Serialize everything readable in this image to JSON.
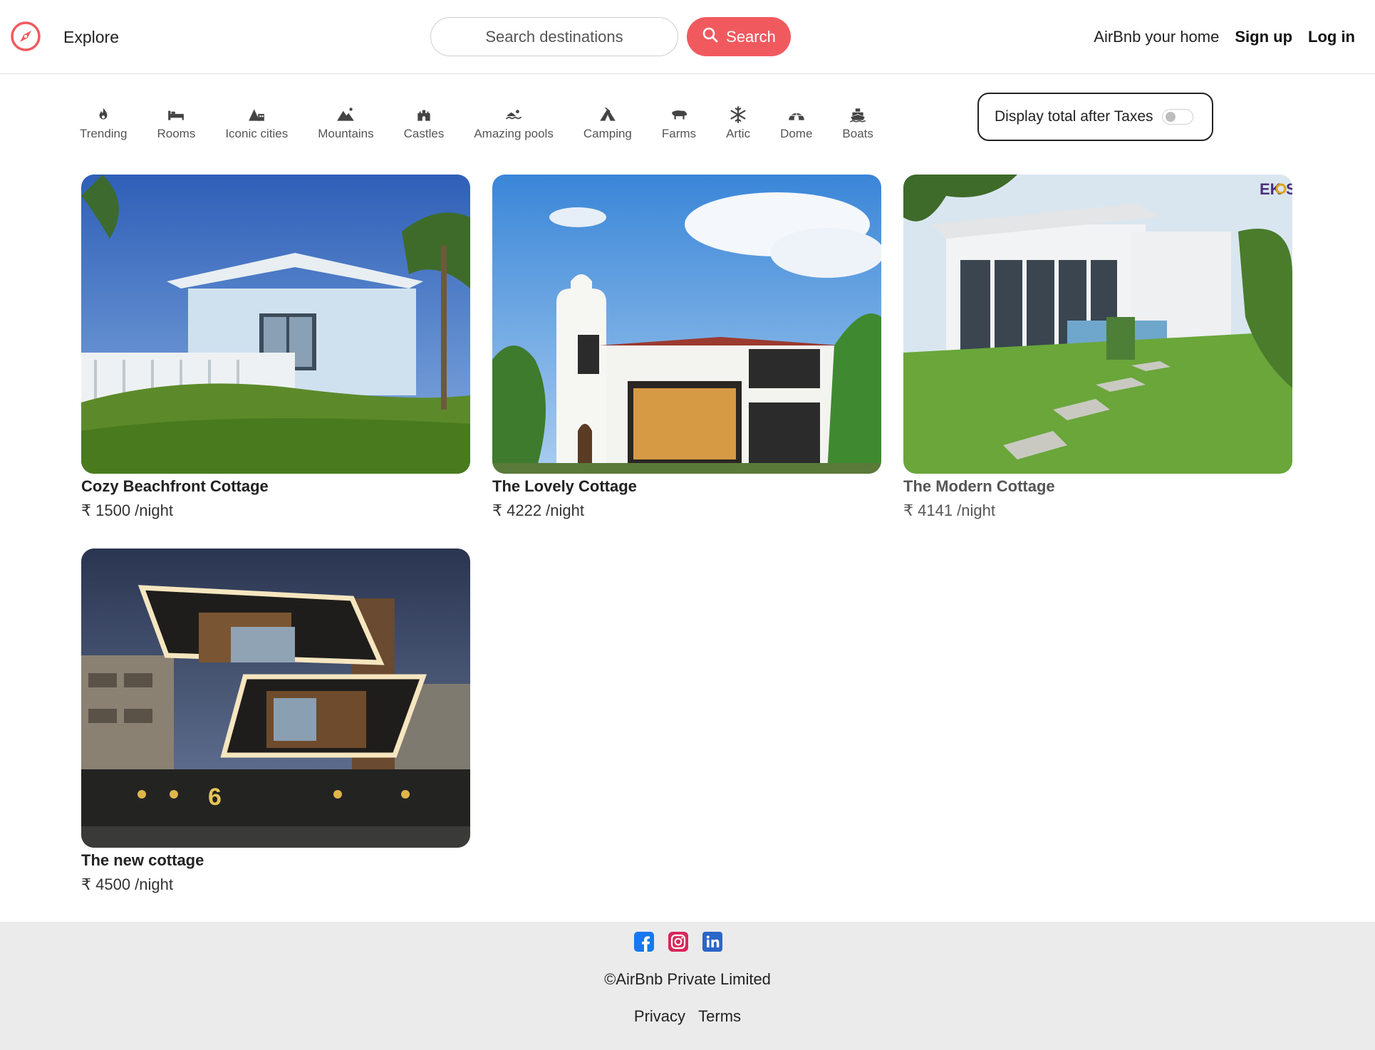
{
  "navbar": {
    "brand_icon": "compass-icon",
    "explore_label": "Explore",
    "search_placeholder": "Search destinations",
    "search_button_label": "Search",
    "host_label": "AirBnb your home",
    "signup_label": "Sign up",
    "login_label": "Log in",
    "accent_color": "#f05a5f"
  },
  "filters": [
    {
      "label": "Trending",
      "icon": "fire-icon"
    },
    {
      "label": "Rooms",
      "icon": "bed-icon"
    },
    {
      "label": "Iconic cities",
      "icon": "city-icon"
    },
    {
      "label": "Mountains",
      "icon": "mountain-icon"
    },
    {
      "label": "Castles",
      "icon": "castle-icon"
    },
    {
      "label": "Amazing pools",
      "icon": "swimmer-icon"
    },
    {
      "label": "Camping",
      "icon": "tent-icon"
    },
    {
      "label": "Farms",
      "icon": "cow-icon"
    },
    {
      "label": "Artic",
      "icon": "snowflake-icon"
    },
    {
      "label": "Dome",
      "icon": "igloo-icon"
    },
    {
      "label": "Boats",
      "icon": "ship-icon"
    }
  ],
  "tax_toggle": {
    "label": "Display total after Taxes",
    "enabled": false
  },
  "listings": [
    {
      "title": "Cozy Beachfront Cottage",
      "price": "₹ 1500 /night"
    },
    {
      "title": "The Lovely Cottage",
      "price": "₹ 4222 /night"
    },
    {
      "title": "The Modern Cottage",
      "price": "₹ 4141 /night"
    },
    {
      "title": "The new cottage",
      "price": "₹ 4500 /night"
    }
  ],
  "footer": {
    "social_icons": [
      "facebook-icon",
      "instagram-icon",
      "linkedin-icon"
    ],
    "copyright": "©AirBnb Private Limited",
    "privacy_label": "Privacy",
    "terms_label": "Terms",
    "background": "#ebebeb"
  }
}
